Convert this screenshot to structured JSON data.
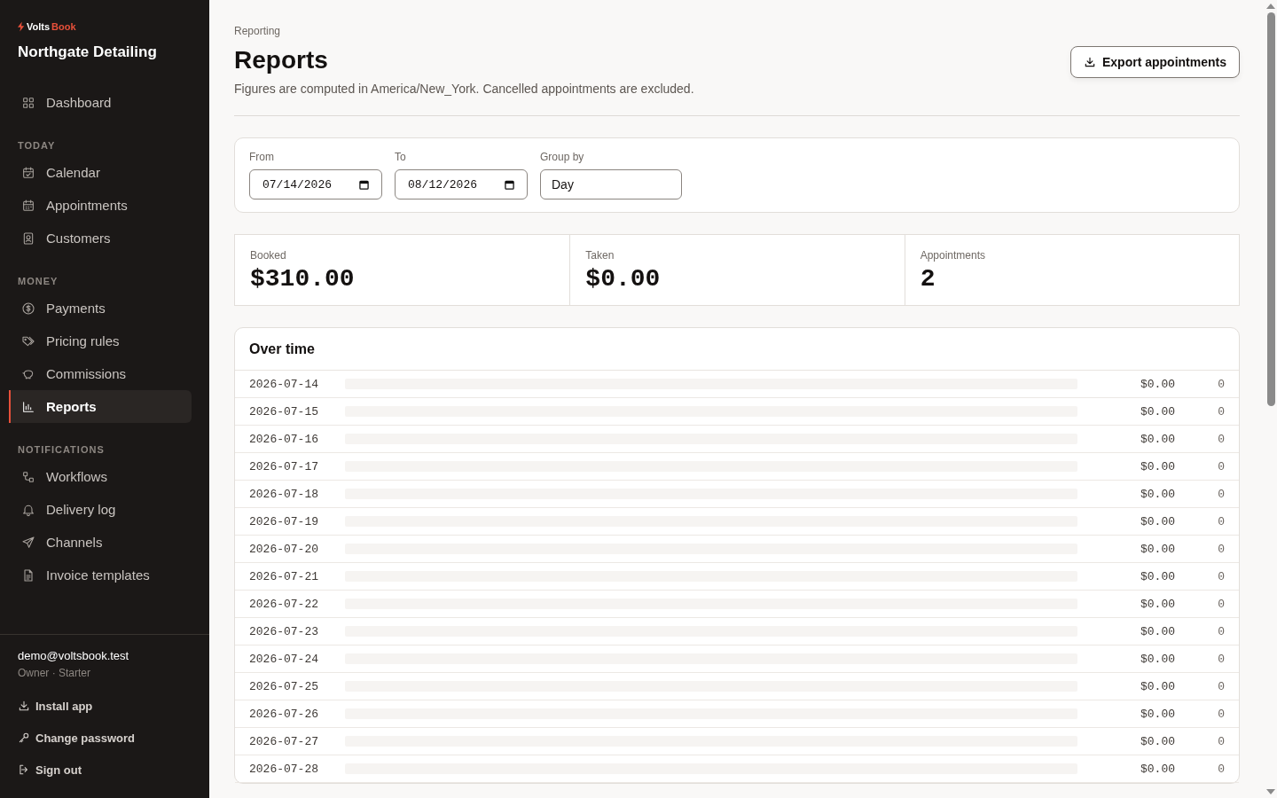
{
  "sidebar": {
    "brand_prefix": "Volts",
    "brand_suffix": "Book",
    "business": "Northgate Detailing",
    "sections": [
      {
        "items": [
          {
            "label": "Dashboard",
            "selected": false
          }
        ]
      },
      {
        "heading": "TODAY",
        "items": [
          {
            "label": "Calendar",
            "selected": false
          },
          {
            "label": "Appointments",
            "selected": false
          },
          {
            "label": "Customers",
            "selected": false
          }
        ]
      },
      {
        "heading": "MONEY",
        "items": [
          {
            "label": "Payments",
            "selected": false
          },
          {
            "label": "Pricing rules",
            "selected": false
          },
          {
            "label": "Commissions",
            "selected": false
          },
          {
            "label": "Reports",
            "selected": true
          }
        ]
      },
      {
        "heading": "NOTIFICATIONS",
        "items": [
          {
            "label": "Workflows",
            "selected": false
          },
          {
            "label": "Delivery log",
            "selected": false
          },
          {
            "label": "Channels",
            "selected": false
          },
          {
            "label": "Invoice templates",
            "selected": false
          }
        ]
      }
    ],
    "user": {
      "email": "demo@voltsbook.test",
      "role": "Owner · Starter"
    },
    "actions": [
      "Install app",
      "Change password",
      "Sign out"
    ]
  },
  "header": {
    "eyebrow": "Reporting",
    "title": "Reports",
    "subtitle": "Figures are computed in America/New_York. Cancelled appointments are excluded.",
    "export_button": "Export appointments"
  },
  "filters": [
    {
      "label": "From",
      "value": "07/14/2026",
      "kind": "date"
    },
    {
      "label": "To",
      "value": "08/12/2026",
      "kind": "date"
    },
    {
      "label": "Group by",
      "value": "Day",
      "kind": "select"
    }
  ],
  "stats": [
    {
      "label": "Booked",
      "value": "$310.00"
    },
    {
      "label": "Taken",
      "value": "$0.00"
    },
    {
      "label": "Appointments",
      "value": "2"
    }
  ],
  "over_time": {
    "title": "Over time",
    "rows": [
      {
        "date": "2026-07-14",
        "level": 0,
        "amount": "$0.00",
        "count": "0"
      },
      {
        "date": "2026-07-15",
        "level": 0,
        "amount": "$0.00",
        "count": "0"
      },
      {
        "date": "2026-07-16",
        "level": 0,
        "amount": "$0.00",
        "count": "0"
      },
      {
        "date": "2026-07-17",
        "level": 0,
        "amount": "$0.00",
        "count": "0"
      },
      {
        "date": "2026-07-18",
        "level": 0,
        "amount": "$0.00",
        "count": "0"
      },
      {
        "date": "2026-07-19",
        "level": 0,
        "amount": "$0.00",
        "count": "0"
      },
      {
        "date": "2026-07-20",
        "level": 0,
        "amount": "$0.00",
        "count": "0"
      },
      {
        "date": "2026-07-21",
        "level": 0,
        "amount": "$0.00",
        "count": "0"
      },
      {
        "date": "2026-07-22",
        "level": 0,
        "amount": "$0.00",
        "count": "0"
      },
      {
        "date": "2026-07-23",
        "level": 0,
        "amount": "$0.00",
        "count": "0"
      },
      {
        "date": "2026-07-24",
        "level": 0,
        "amount": "$0.00",
        "count": "0"
      },
      {
        "date": "2026-07-25",
        "level": 0,
        "amount": "$0.00",
        "count": "0"
      },
      {
        "date": "2026-07-26",
        "level": 0,
        "amount": "$0.00",
        "count": "0"
      },
      {
        "date": "2026-07-27",
        "level": 0,
        "amount": "$0.00",
        "count": "0"
      },
      {
        "date": "2026-07-28",
        "level": 0,
        "amount": "$0.00",
        "count": "0"
      }
    ]
  }
}
